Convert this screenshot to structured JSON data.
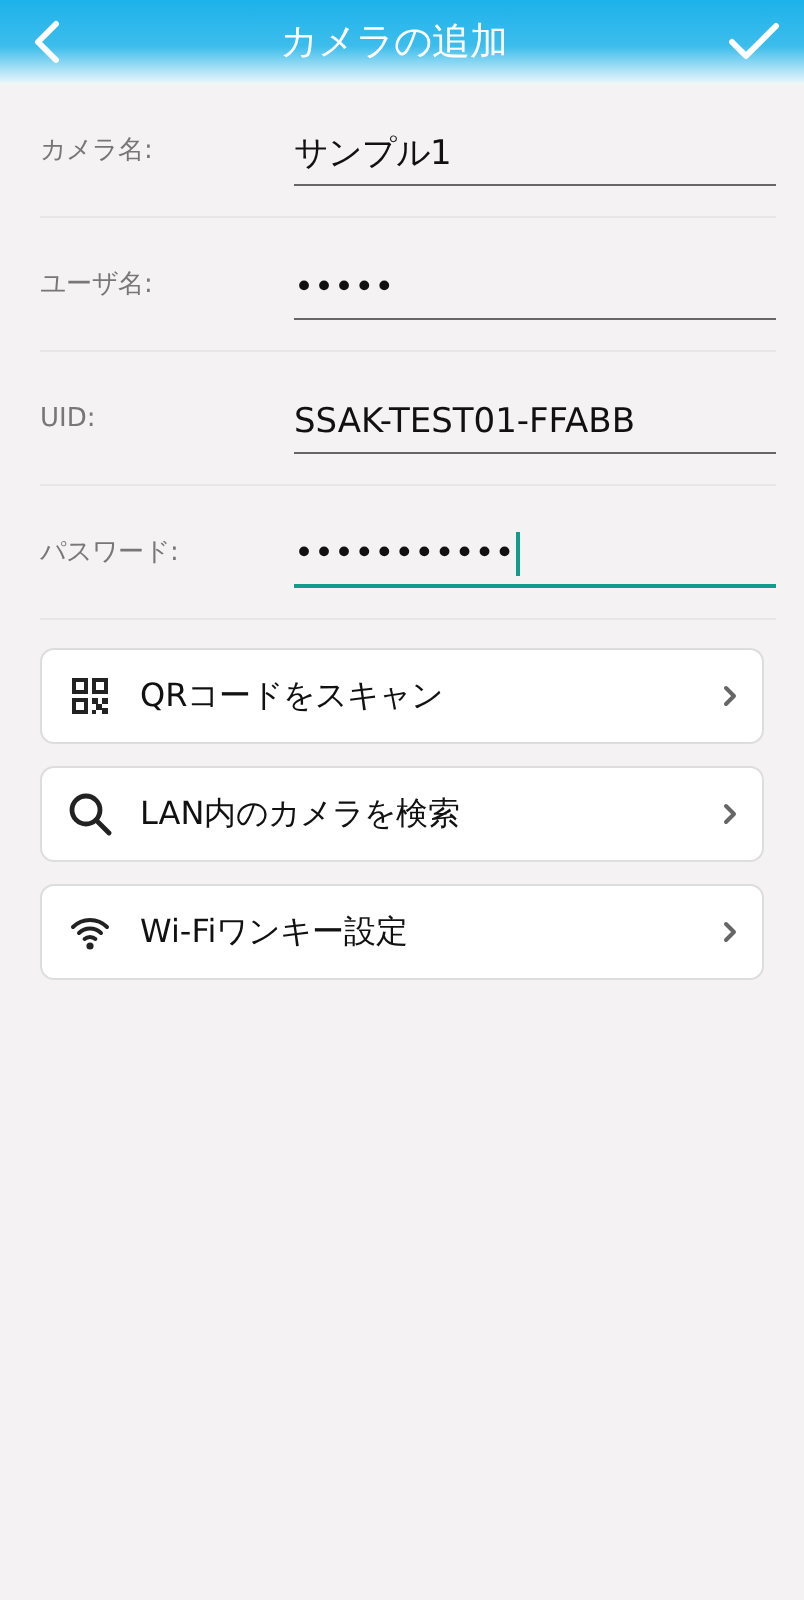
{
  "header": {
    "title": "カメラの追加"
  },
  "fields": [
    {
      "label": "カメラ名:",
      "value": "サンプル1",
      "focused": false
    },
    {
      "label": "ユーザ名:",
      "value": "•••••",
      "focused": false
    },
    {
      "label": "UID:",
      "value": "SSAK-TEST01-FFABB",
      "focused": false
    },
    {
      "label": "パスワード:",
      "value": "•••••••••••",
      "focused": true
    }
  ],
  "actions": [
    {
      "kind": "qr",
      "label": "QRコードをスキャン"
    },
    {
      "kind": "search",
      "label": "LAN内のカメラを検索"
    },
    {
      "kind": "wifi",
      "label": "Wi-Fiワンキー設定"
    }
  ]
}
